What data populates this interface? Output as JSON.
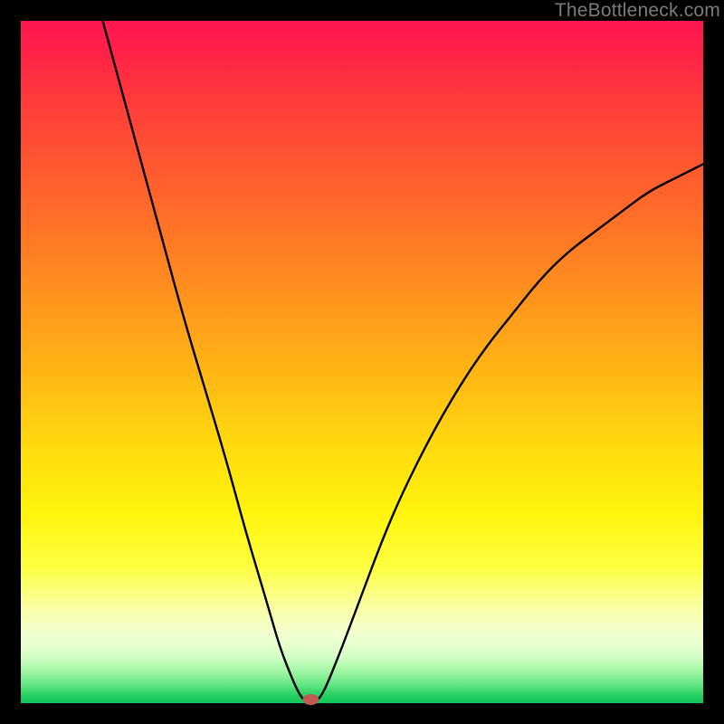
{
  "watermark": "TheBottleneck.com",
  "chart_data": {
    "type": "line",
    "title": "",
    "xlabel": "",
    "ylabel": "",
    "xlim": [
      0,
      100
    ],
    "ylim": [
      0,
      100
    ],
    "gradient_stops": [
      {
        "pos": 0,
        "color": "#ff1751"
      },
      {
        "pos": 12,
        "color": "#ff3c3a"
      },
      {
        "pos": 32,
        "color": "#ff7825"
      },
      {
        "pos": 52,
        "color": "#ffb814"
      },
      {
        "pos": 72,
        "color": "#fff40b"
      },
      {
        "pos": 86,
        "color": "#faffa5"
      },
      {
        "pos": 93,
        "color": "#d7ffc8"
      },
      {
        "pos": 100,
        "color": "#15c557"
      }
    ],
    "series": [
      {
        "name": "bottleneck-curve",
        "x": [
          12,
          15,
          18,
          21,
          24,
          27,
          30,
          33,
          36,
          38,
          40,
          41,
          42,
          43,
          44,
          45,
          47,
          50,
          53,
          56,
          60,
          64,
          68,
          72,
          76,
          80,
          84,
          88,
          92,
          96,
          100
        ],
        "y": [
          100,
          89,
          78,
          67,
          56,
          46,
          36,
          25,
          15,
          8,
          3,
          1,
          0,
          0,
          1,
          3,
          8,
          16,
          24,
          31,
          39,
          46,
          52,
          57,
          62,
          66,
          69,
          72,
          75,
          77,
          79
        ]
      }
    ],
    "marker": {
      "x": 42.5,
      "y": 0,
      "color": "#c15b53"
    }
  }
}
